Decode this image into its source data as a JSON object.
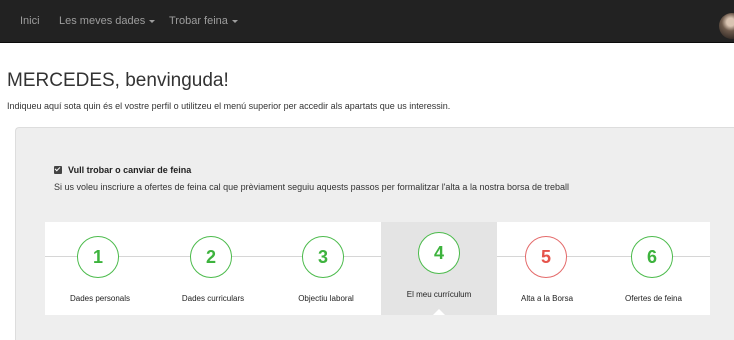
{
  "nav": {
    "home": "Inici",
    "my_data": "Les meves dades",
    "find_job": "Trobar feina"
  },
  "page": {
    "title": "MERCEDES, benvinguda!",
    "intro": "Indiqueu aquí sota quin és el vostre perfil o utilitzeu el menú superior per accedir als apartats que us interessin."
  },
  "panel": {
    "checkbox_label": "Vull trobar o canviar de feina",
    "checkbox_checked": true,
    "description": "Si us voleu inscriure a ofertes de feina cal que prèviament seguiu aquests passos per formalitzar l'alta a la nostra borsa de treball"
  },
  "steps": [
    {
      "number": "1",
      "label": "Dades personals",
      "status": "done"
    },
    {
      "number": "2",
      "label": "Dades curriculars",
      "status": "done"
    },
    {
      "number": "3",
      "label": "Objectiu laboral",
      "status": "done"
    },
    {
      "number": "4",
      "label": "El meu currículum",
      "status": "active"
    },
    {
      "number": "5",
      "label": "Alta a la Borsa",
      "status": "pending"
    },
    {
      "number": "6",
      "label": "Ofertes de feina",
      "status": "done"
    }
  ],
  "colors": {
    "navbar": "#222222",
    "step_done": "#3db33d",
    "step_pending": "#e5534b",
    "panel_bg": "#eeeeee"
  }
}
